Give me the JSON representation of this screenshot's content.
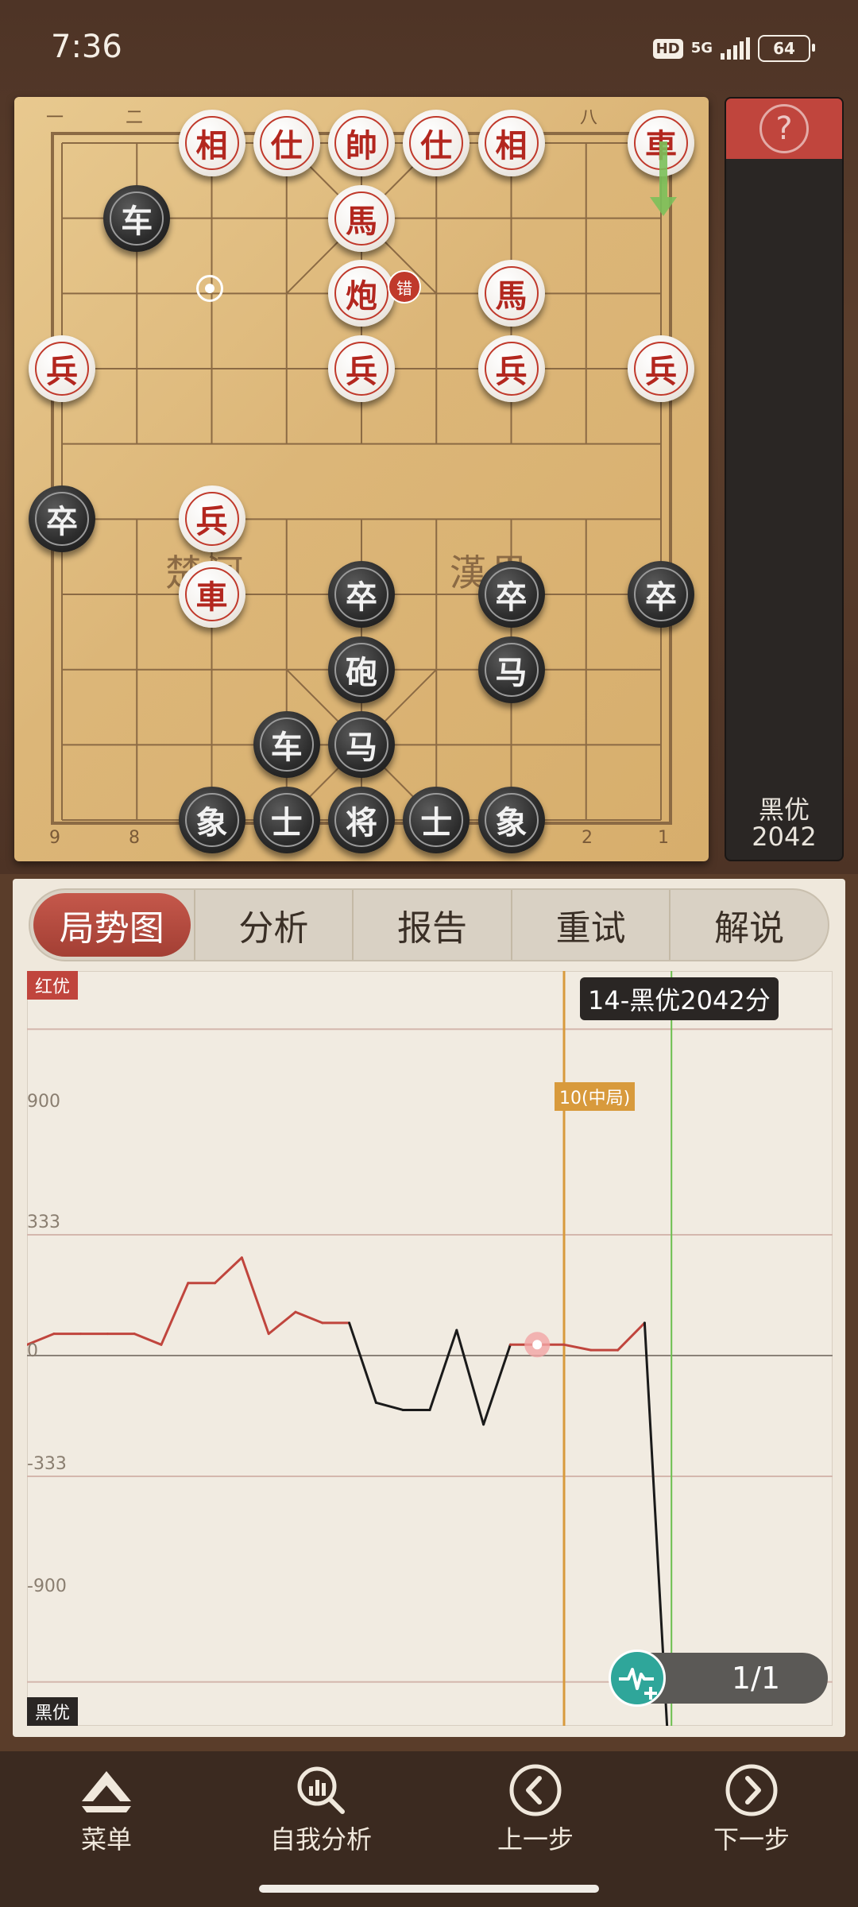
{
  "status_bar": {
    "time": "7:36",
    "hd": "HD",
    "network": "5G",
    "battery": "64"
  },
  "board": {
    "river_left": "楚河",
    "river_right": "漢界",
    "top_file_labels": [
      "一",
      "二",
      "八"
    ],
    "bottom_file_labels": [
      "9",
      "8",
      "2",
      "1"
    ],
    "error_badge": "错",
    "pieces": [
      {
        "side": "red",
        "char": "相",
        "file": 2,
        "rank": 0
      },
      {
        "side": "red",
        "char": "仕",
        "file": 3,
        "rank": 0
      },
      {
        "side": "red",
        "char": "帥",
        "file": 4,
        "rank": 0
      },
      {
        "side": "red",
        "char": "仕",
        "file": 5,
        "rank": 0
      },
      {
        "side": "red",
        "char": "相",
        "file": 6,
        "rank": 0
      },
      {
        "side": "red",
        "char": "車",
        "file": 8,
        "rank": 0
      },
      {
        "side": "black",
        "char": "车",
        "file": 1,
        "rank": 1
      },
      {
        "side": "red",
        "char": "馬",
        "file": 4,
        "rank": 1
      },
      {
        "side": "red",
        "char": "炮",
        "file": 4,
        "rank": 2
      },
      {
        "side": "red",
        "char": "馬",
        "file": 6,
        "rank": 2
      },
      {
        "side": "red",
        "char": "兵",
        "file": 0,
        "rank": 3
      },
      {
        "side": "red",
        "char": "兵",
        "file": 4,
        "rank": 3
      },
      {
        "side": "red",
        "char": "兵",
        "file": 6,
        "rank": 3
      },
      {
        "side": "red",
        "char": "兵",
        "file": 8,
        "rank": 3
      },
      {
        "side": "black",
        "char": "卒",
        "file": 0,
        "rank": 5
      },
      {
        "side": "red",
        "char": "兵",
        "file": 2,
        "rank": 5
      },
      {
        "side": "red",
        "char": "車",
        "file": 2,
        "rank": 6
      },
      {
        "side": "black",
        "char": "卒",
        "file": 4,
        "rank": 6
      },
      {
        "side": "black",
        "char": "卒",
        "file": 6,
        "rank": 6
      },
      {
        "side": "black",
        "char": "卒",
        "file": 8,
        "rank": 6
      },
      {
        "side": "black",
        "char": "砲",
        "file": 4,
        "rank": 7
      },
      {
        "side": "black",
        "char": "马",
        "file": 6,
        "rank": 7
      },
      {
        "side": "black",
        "char": "车",
        "file": 3,
        "rank": 8
      },
      {
        "side": "black",
        "char": "马",
        "file": 4,
        "rank": 8
      },
      {
        "side": "black",
        "char": "象",
        "file": 2,
        "rank": 9
      },
      {
        "side": "black",
        "char": "士",
        "file": 3,
        "rank": 9
      },
      {
        "side": "black",
        "char": "将",
        "file": 4,
        "rank": 9
      },
      {
        "side": "black",
        "char": "士",
        "file": 5,
        "rank": 9
      },
      {
        "side": "black",
        "char": "象",
        "file": 6,
        "rank": 9
      }
    ]
  },
  "side_panel": {
    "help_icon": "question-icon",
    "advantage_label": "黑优",
    "advantage_score": "2042"
  },
  "tabs": [
    "局势图",
    "分析",
    "报告",
    "重试",
    "解说"
  ],
  "chart_data": {
    "type": "line",
    "tag_top": "红优",
    "tag_bottom": "黑优",
    "yticks": [
      "900",
      "333",
      "0",
      "-333",
      "-900"
    ],
    "tooltip": "14-黑优2042分",
    "phase_marker": "10(中局)",
    "x": [
      0,
      0.5,
      1,
      1.5,
      2,
      2.5,
      3,
      3.5,
      4,
      4.5,
      5,
      5.5,
      6,
      6.5,
      7,
      7.5,
      8,
      8.5,
      9,
      9.5,
      10,
      10.5,
      11,
      11.5,
      12,
      12.5,
      13,
      13.5,
      14,
      14.5,
      15
    ],
    "values": [
      30,
      60,
      60,
      60,
      60,
      30,
      200,
      200,
      270,
      60,
      120,
      90,
      90,
      -130,
      -150,
      -150,
      70,
      -190,
      30,
      30,
      30,
      15,
      15,
      90,
      -1240,
      -1240,
      -1240,
      -1240,
      -1280,
      -1360,
      -1360
    ],
    "highlight_index": 19,
    "current_index": 24,
    "page_indicator": "1/1",
    "colors": {
      "red_line": "#c0453d",
      "black_line": "#1a1a1a",
      "phase": "#d89a3c",
      "current": "#6cbf4f"
    }
  },
  "bottom_nav": [
    {
      "label": "菜单",
      "icon": "menu-icon"
    },
    {
      "label": "自我分析",
      "icon": "self-analysis-icon"
    },
    {
      "label": "上一步",
      "icon": "previous-icon"
    },
    {
      "label": "下一步",
      "icon": "next-icon"
    }
  ]
}
